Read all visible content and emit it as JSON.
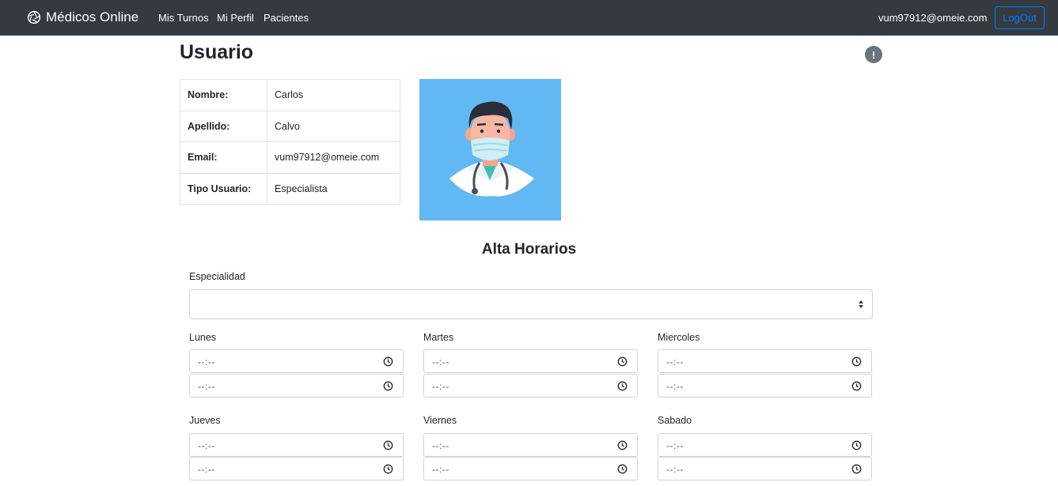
{
  "navbar": {
    "brand": "Médicos Online",
    "brand_icon": "aperture-icon",
    "links": [
      "Mis Turnos",
      "Mi Perfil",
      "Pacientes"
    ],
    "user_email": "vum97912@omeie.com",
    "logout_label": "LogOut"
  },
  "page": {
    "title": "Usuario",
    "alert_symbol": "!"
  },
  "user": {
    "rows": [
      {
        "key": "Nombre:",
        "value": "Carlos"
      },
      {
        "key": "Apellido:",
        "value": "Calvo"
      },
      {
        "key": "Email:",
        "value": "vum97912@omeie.com"
      },
      {
        "key": "Tipo Usuario:",
        "value": "Especialista"
      }
    ],
    "avatar_icon": "doctor-avatar-icon"
  },
  "form": {
    "title": "Alta Horarios",
    "specialty_label": "Especialidad",
    "specialty_value": "",
    "days": [
      "Lunes",
      "Martes",
      "Miercoles",
      "Jueves",
      "Viernes",
      "Sabado"
    ],
    "time_placeholder": "--:--"
  },
  "colors": {
    "navbar_bg": "#343a40",
    "primary": "#007bff",
    "avatar_bg": "#62b8f2"
  }
}
